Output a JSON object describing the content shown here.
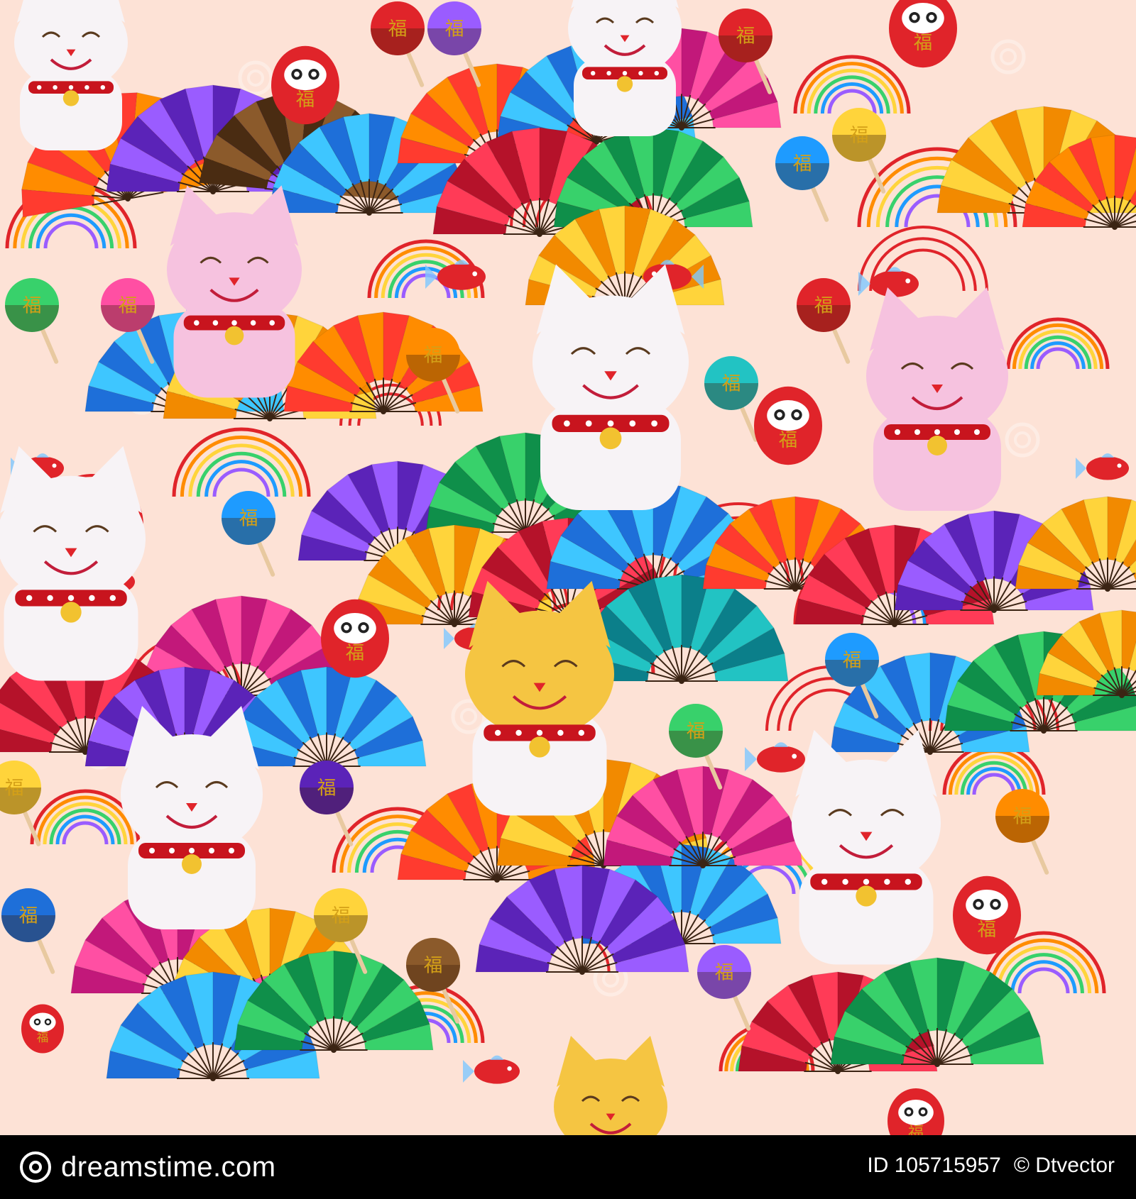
{
  "colors": {
    "background": "#fde2d6",
    "accent_red": "#e0242a",
    "gold": "#d4a017",
    "footer": "#000000"
  },
  "motif": {
    "fan_char": "福",
    "icons": [
      "maneki-neko-cat-icon",
      "daruma-doll-icon",
      "folding-fan-icon",
      "uchiwa-fan-icon",
      "rainbow-arc-icon",
      "koi-fish-icon"
    ]
  },
  "footer": {
    "logo_text": "dreamstime.com",
    "id_label": "ID 105715957",
    "author": "© Dtvector"
  }
}
